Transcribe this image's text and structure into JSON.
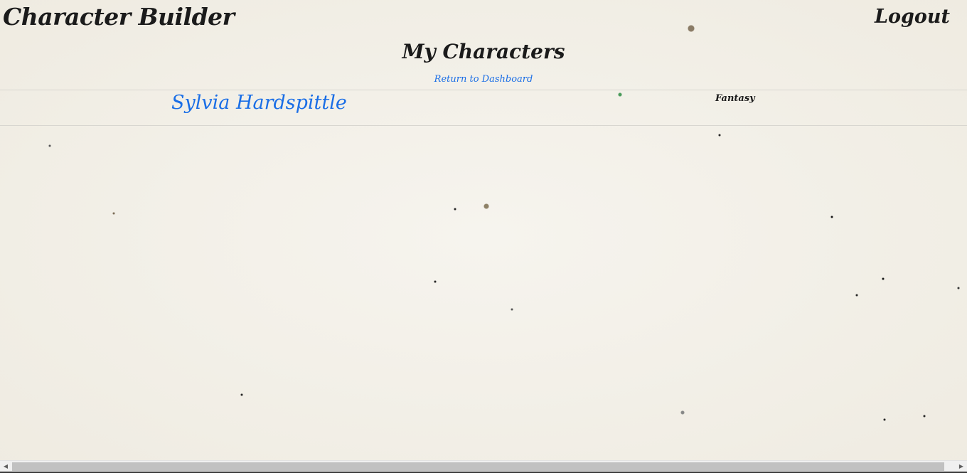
{
  "header": {
    "brand": "Character Builder",
    "logout_label": "Logout"
  },
  "main": {
    "title": "My Characters",
    "return_link": "Return to Dashboard",
    "characters": [
      {
        "name": "Sylvia Hardspittle",
        "genre": "Fantasy"
      }
    ]
  },
  "scrollbar": {
    "left_arrow_icon": "triangle-left-icon",
    "right_arrow_icon": "triangle-right-icon",
    "left_arrow_glyph": "◀",
    "right_arrow_glyph": "▶"
  },
  "colors": {
    "link": "#1a6ee6",
    "text": "#1b1b1b",
    "background": "#f3f0e8"
  }
}
